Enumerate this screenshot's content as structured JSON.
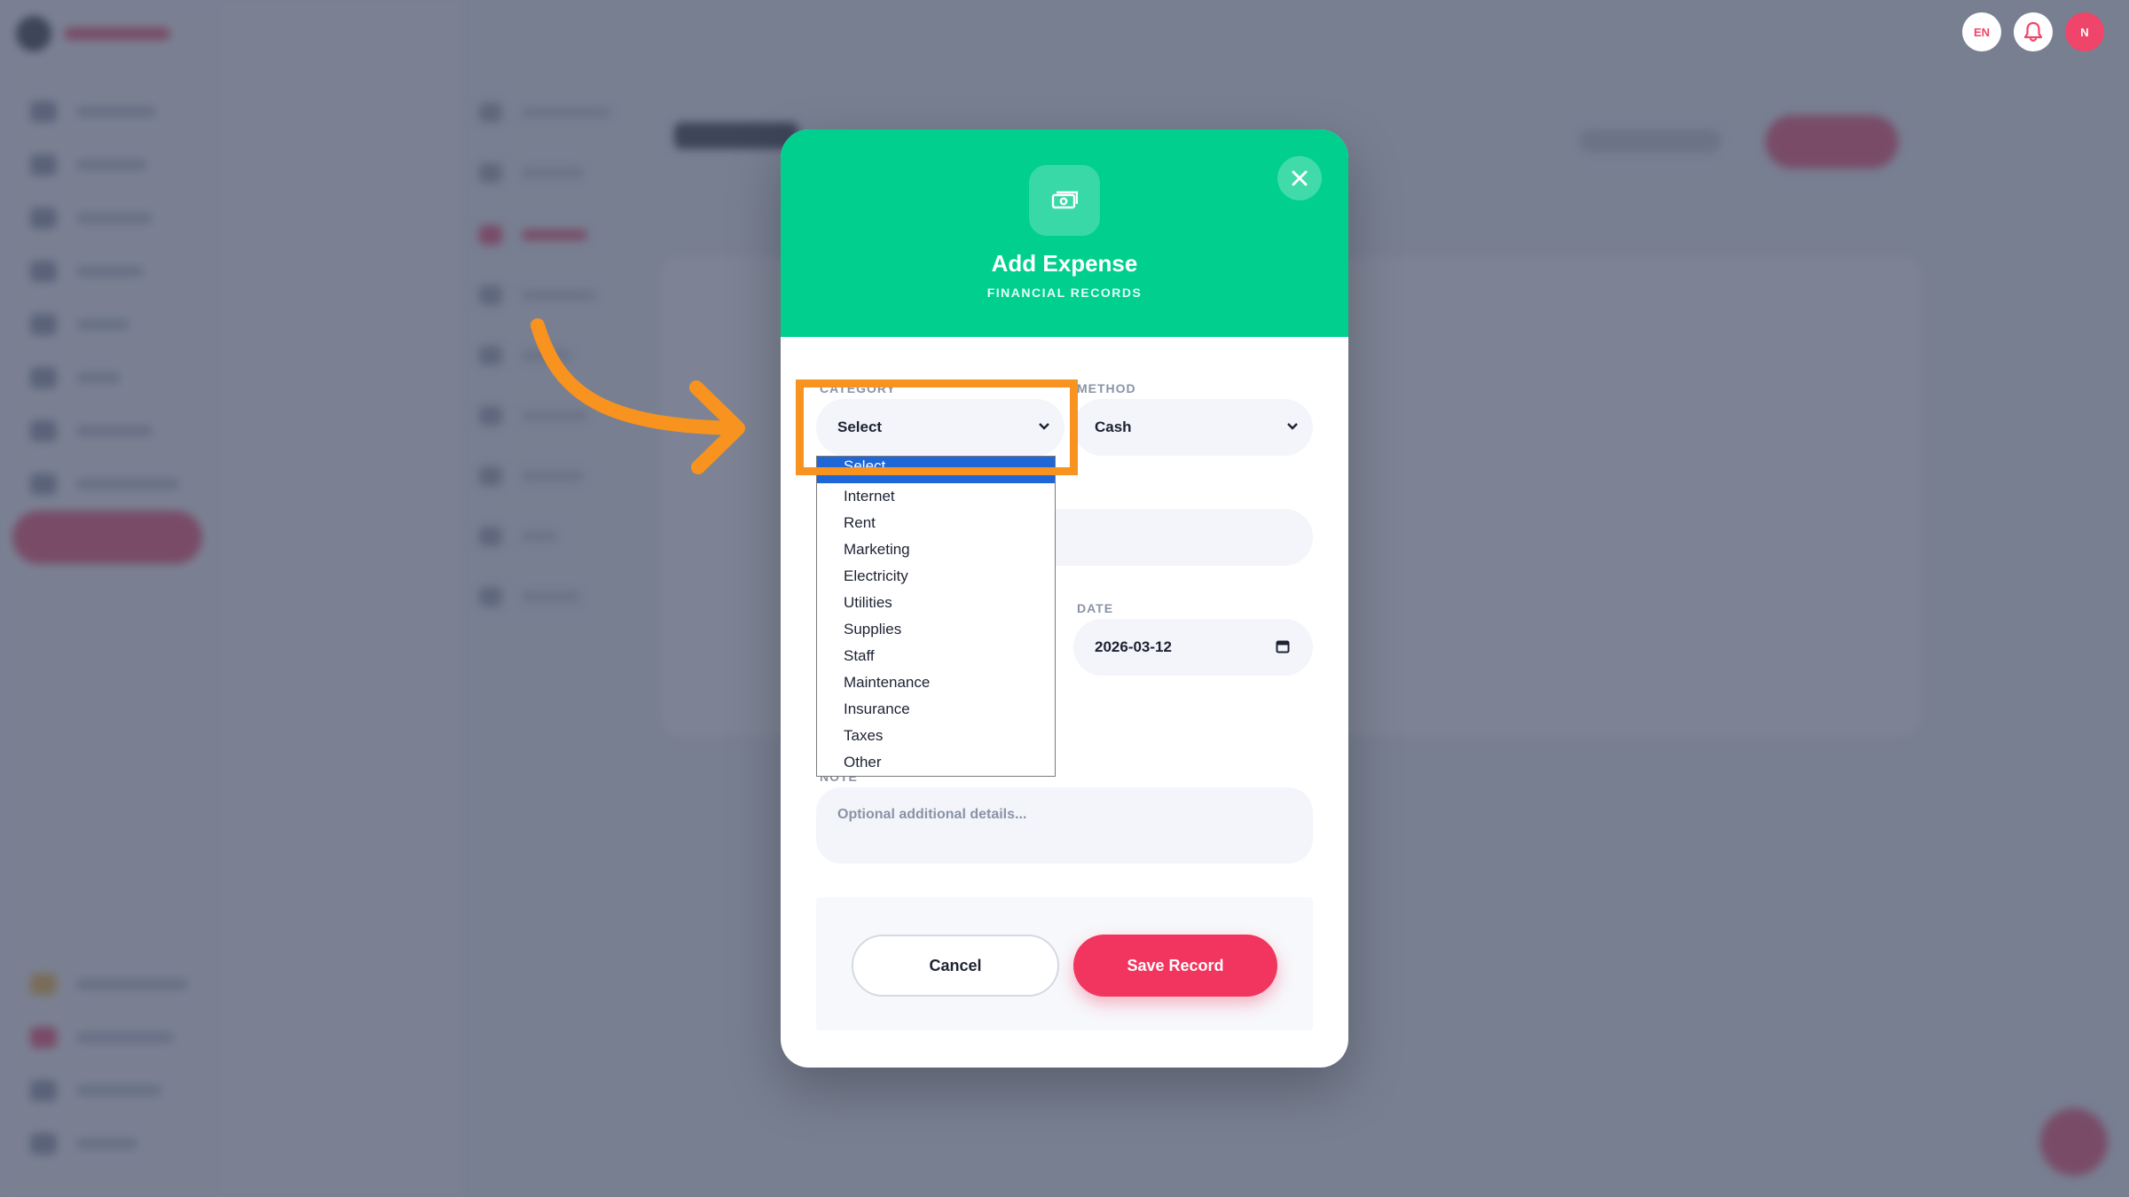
{
  "header": {
    "language": "EN",
    "avatar_initial": "N"
  },
  "modal": {
    "icon": "money-icon",
    "title": "Add Expense",
    "subtitle": "FINANCIAL RECORDS",
    "category": {
      "label": "CATEGORY",
      "value": "Select",
      "options": [
        "Select",
        "Internet",
        "Rent",
        "Marketing",
        "Electricity",
        "Utilities",
        "Supplies",
        "Staff",
        "Maintenance",
        "Insurance",
        "Taxes",
        "Other"
      ],
      "selected_option": "Select"
    },
    "method": {
      "label": "METHOD",
      "value": "Cash"
    },
    "date": {
      "label": "DATE",
      "value": "2026-03-12"
    },
    "note": {
      "label": "NOTE",
      "placeholder": "Optional additional details..."
    },
    "cancel_label": "Cancel",
    "save_label": "Save Record"
  },
  "colors": {
    "header_green": "#00cf8d",
    "accent_red": "#f2355e",
    "annotation_orange": "#f7931e",
    "selection_blue": "#1f66d6"
  }
}
